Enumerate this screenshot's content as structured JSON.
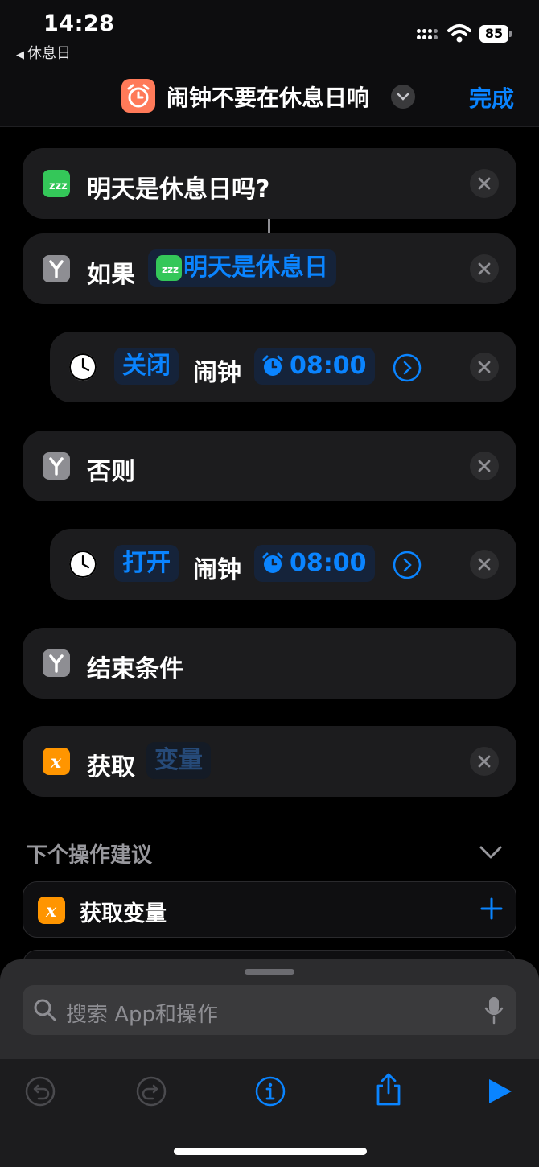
{
  "status_bar": {
    "time": "14:28",
    "back_app": "休息日",
    "battery": "85"
  },
  "nav": {
    "title": "闹钟不要在休息日响",
    "done_label": "完成"
  },
  "actions": [
    {
      "label": "明天是休息日吗?"
    },
    {
      "label": "如果",
      "token": "明天是休息日"
    },
    {
      "token_action": "关闭",
      "label": "闹钟",
      "time": "08:00"
    },
    {
      "label": "否则"
    },
    {
      "token_action": "打开",
      "label": "闹钟",
      "time": "08:00"
    },
    {
      "label": "结束条件"
    },
    {
      "label": "获取",
      "token": "变量"
    }
  ],
  "suggestions": {
    "header": "下个操作建议",
    "items": [
      {
        "label": "获取变量"
      }
    ]
  },
  "search": {
    "placeholder": "搜索 App和操作"
  },
  "colors": {
    "accent": "#0a84ff",
    "row_bg": "#1c1c1e",
    "sleep_green": "#34c759",
    "variable_orange": "#ff9500",
    "app_icon": "#ff7a59"
  }
}
